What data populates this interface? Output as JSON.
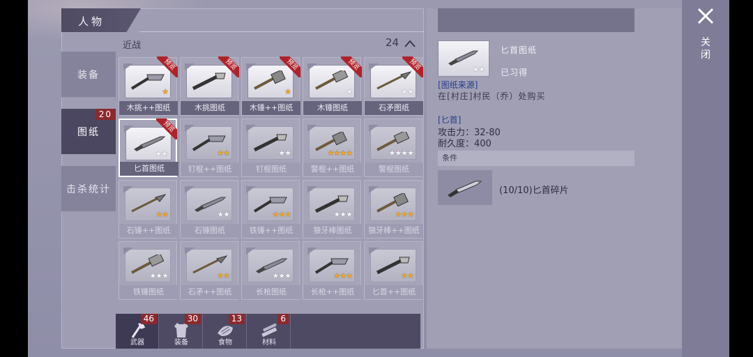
{
  "title": "人物",
  "side_tabs": [
    {
      "label": "装备",
      "badge": ""
    },
    {
      "label": "图纸",
      "badge": "20"
    },
    {
      "label": "击杀统计",
      "badge": ""
    }
  ],
  "list": {
    "category": "近战",
    "count": "24"
  },
  "items": [
    {
      "label": "木挑++图纸",
      "stars": "★",
      "gold": true,
      "ribbon": "预览",
      "dim": false,
      "sel": false
    },
    {
      "label": "木挑图纸",
      "stars": "",
      "gold": false,
      "ribbon": "预览",
      "dim": false,
      "sel": false
    },
    {
      "label": "木锤++图纸",
      "stars": "★",
      "gold": true,
      "ribbon": "预览",
      "dim": false,
      "sel": false
    },
    {
      "label": "木锤图纸",
      "stars": "★",
      "gold": false,
      "ribbon": "预览",
      "dim": false,
      "sel": false
    },
    {
      "label": "石矛图纸",
      "stars": "★★",
      "gold": false,
      "ribbon": "预览",
      "dim": false,
      "sel": false
    },
    {
      "label": "匕首图纸",
      "stars": "★★",
      "gold": false,
      "ribbon": "预览",
      "dim": false,
      "sel": true
    },
    {
      "label": "钉棍++图纸",
      "stars": "★★",
      "gold": true,
      "ribbon": "",
      "dim": true,
      "sel": false
    },
    {
      "label": "钉棍图纸",
      "stars": "★★",
      "gold": false,
      "ribbon": "",
      "dim": true,
      "sel": false
    },
    {
      "label": "警棍++图纸",
      "stars": "★★★★",
      "gold": true,
      "ribbon": "",
      "dim": true,
      "sel": false
    },
    {
      "label": "警棍图纸",
      "stars": "★★★★",
      "gold": false,
      "ribbon": "",
      "dim": true,
      "sel": false
    },
    {
      "label": "石锤++图纸",
      "stars": "★★",
      "gold": true,
      "ribbon": "",
      "dim": true,
      "sel": false
    },
    {
      "label": "石锤图纸",
      "stars": "★★",
      "gold": false,
      "ribbon": "",
      "dim": true,
      "sel": false
    },
    {
      "label": "铁锤++图纸",
      "stars": "★★★",
      "gold": true,
      "ribbon": "",
      "dim": true,
      "sel": false
    },
    {
      "label": "狼牙棒图纸",
      "stars": "★★★",
      "gold": false,
      "ribbon": "",
      "dim": true,
      "sel": false
    },
    {
      "label": "狼牙棒++图纸",
      "stars": "★★★",
      "gold": true,
      "ribbon": "",
      "dim": true,
      "sel": false
    },
    {
      "label": "铁锤图纸",
      "stars": "★★★",
      "gold": false,
      "ribbon": "",
      "dim": true,
      "sel": false
    },
    {
      "label": "石矛++图纸",
      "stars": "★★",
      "gold": true,
      "ribbon": "",
      "dim": true,
      "sel": false
    },
    {
      "label": "长枪图纸",
      "stars": "★★★",
      "gold": false,
      "ribbon": "",
      "dim": true,
      "sel": false
    },
    {
      "label": "长枪++图纸",
      "stars": "★★★",
      "gold": true,
      "ribbon": "",
      "dim": true,
      "sel": false
    },
    {
      "label": "匕首++图纸",
      "stars": "★★",
      "gold": true,
      "ribbon": "",
      "dim": true,
      "sel": false
    }
  ],
  "bottom_tabs": [
    {
      "label": "武器",
      "badge": "46",
      "icon": "axe-icon"
    },
    {
      "label": "装备",
      "badge": "30",
      "icon": "shirt-icon"
    },
    {
      "label": "食物",
      "badge": "13",
      "icon": "food-icon"
    },
    {
      "label": "材料",
      "badge": "6",
      "icon": "wood-icon"
    }
  ],
  "detail": {
    "name": "匕首图纸",
    "learned": "已习得",
    "source_title": "[图纸来源]",
    "source": "在[村庄]村民（乔）处购买",
    "item_title": "[匕首]",
    "attack": "攻击力：32-80",
    "durability": "耐久度：400",
    "condition": "条件",
    "material": "(10/10)匕首碎片"
  },
  "close_label": "关闭"
}
